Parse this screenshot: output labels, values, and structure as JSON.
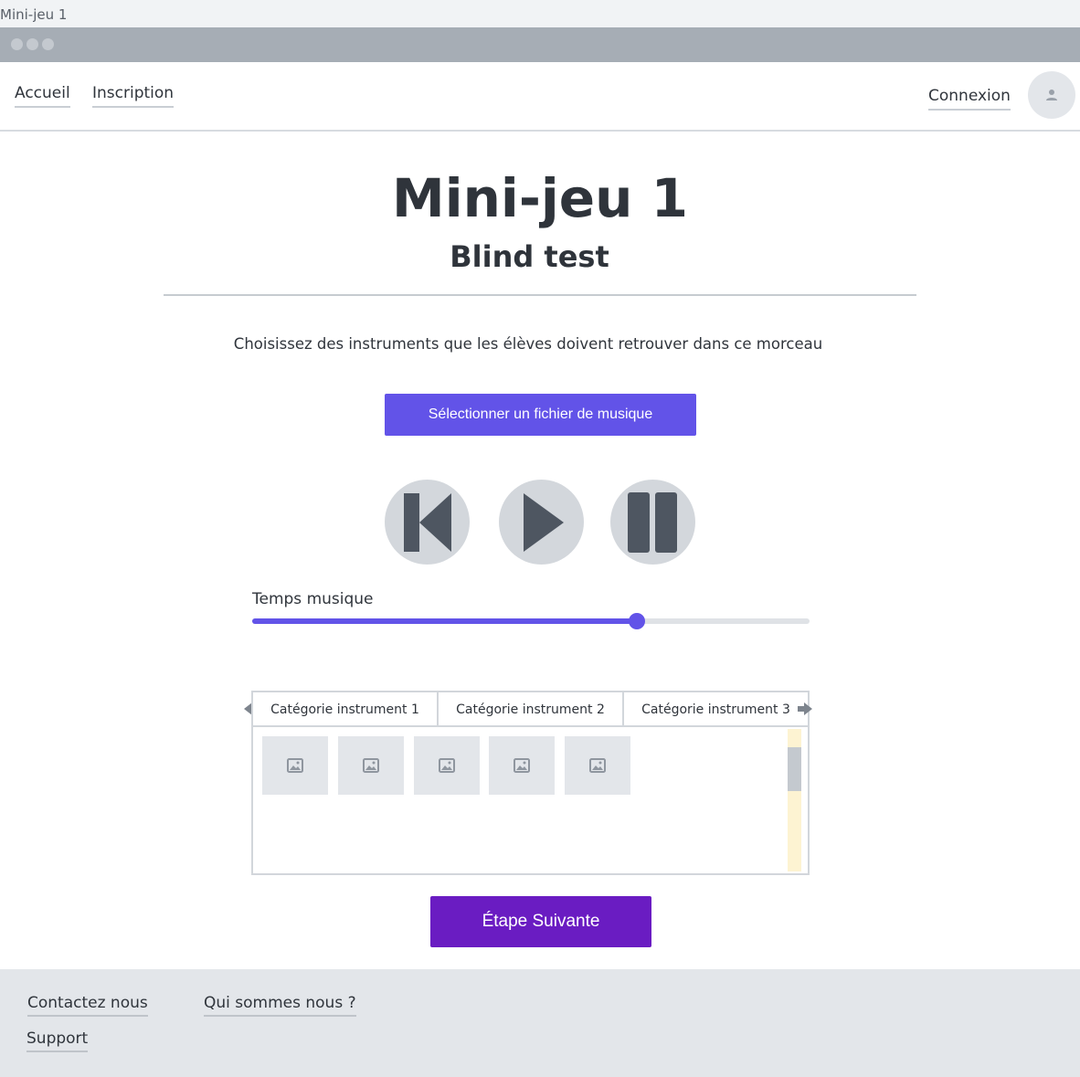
{
  "window": {
    "title": "Mini-jeu 1"
  },
  "nav": {
    "home": "Accueil",
    "signup": "Inscription",
    "login": "Connexion",
    "avatar_icon": "user-icon"
  },
  "page": {
    "title": "Mini-jeu 1",
    "subtitle": "Blind test",
    "instructions": "Choisissez des instruments que les élèves doivent retrouver dans ce morceau",
    "select_file_label": "Sélectionner un fichier de musique"
  },
  "player": {
    "buttons": [
      "skip-back-icon",
      "play-icon",
      "pause-icon"
    ],
    "slider_label": "Temps musique",
    "progress": 0.69
  },
  "instruments": {
    "tabs": [
      "Catégorie instrument 1",
      "Catégorie instrument 2",
      "Catégorie instrument 3"
    ],
    "items": [
      "image-icon",
      "image-icon",
      "image-icon",
      "image-icon",
      "image-icon"
    ]
  },
  "next_button": {
    "label": "Étape Suivante"
  },
  "footer": {
    "contact": "Contactez nous",
    "about": "Qui sommes nous ?",
    "support": "Support"
  },
  "colors": {
    "accent": "#6253e8",
    "next_button": "#6a1cc2",
    "footer_bg": "#e3e6ea",
    "icon_dark": "#4e5661"
  }
}
